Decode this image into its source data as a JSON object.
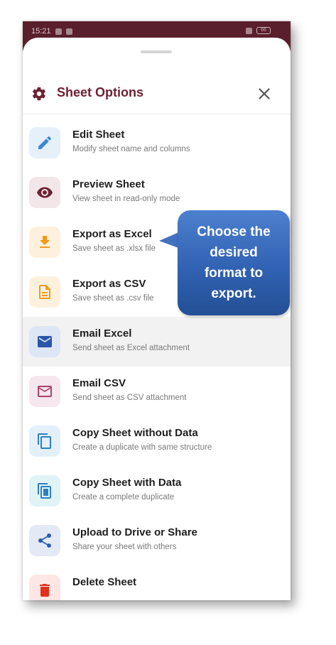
{
  "status_bar": {
    "time": "15:21",
    "battery": "66"
  },
  "header": {
    "title": "Sheet Options"
  },
  "menu": [
    {
      "title": "Edit Sheet",
      "subtitle": "Modify sheet name and columns",
      "icon": "pencil-icon",
      "icon_color": "#3d86d6",
      "bg": "#e6f0fb"
    },
    {
      "title": "Preview Sheet",
      "subtitle": "View sheet in read-only mode",
      "icon": "eye-icon",
      "icon_color": "#6d2233",
      "bg": "#f2e6e8"
    },
    {
      "title": "Export as Excel",
      "subtitle": "Save sheet as .xlsx file",
      "icon": "download-icon",
      "icon_color": "#f29a18",
      "bg": "#fdf1dd"
    },
    {
      "title": "Export as CSV",
      "subtitle": "Save sheet as .csv file",
      "icon": "document-icon",
      "icon_color": "#f29a18",
      "bg": "#fdf1dd"
    },
    {
      "title": "Email Excel",
      "subtitle": "Send sheet as Excel attachment",
      "icon": "mail-filled-icon",
      "icon_color": "#2a56a8",
      "bg": "#dde6f4"
    },
    {
      "title": "Email CSV",
      "subtitle": "Send sheet as CSV attachment",
      "icon": "mail-outline-icon",
      "icon_color": "#a8456a",
      "bg": "#f6e6ed"
    },
    {
      "title": "Copy Sheet without Data",
      "subtitle": "Create a duplicate with same structure",
      "icon": "copy-icon",
      "icon_color": "#2d7fbf",
      "bg": "#e3f0fa"
    },
    {
      "title": "Copy Sheet with Data",
      "subtitle": "Create a complete duplicate",
      "icon": "copy-filled-icon",
      "icon_color": "#2d7fbf",
      "bg": "#e0f3f7"
    },
    {
      "title": "Upload to Drive or Share",
      "subtitle": "Share your sheet with others",
      "icon": "share-icon",
      "icon_color": "#2a5cb0",
      "bg": "#e3eaf6"
    },
    {
      "title": "Delete Sheet",
      "subtitle": "",
      "icon": "trash-icon",
      "icon_color": "#e0321f",
      "bg": "#fde6e4"
    }
  ],
  "callout": {
    "text": "Choose the desired format to export."
  },
  "colors": {
    "accent": "#6d2233",
    "status_bar": "#5a1f2c",
    "highlight_row": "#f2f2f2",
    "callout": "#3162b3"
  }
}
